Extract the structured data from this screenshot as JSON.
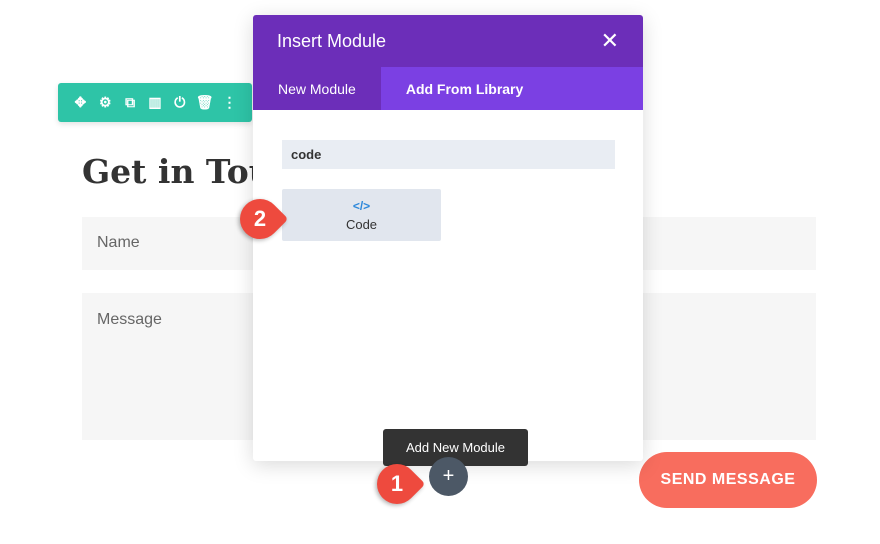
{
  "toolbar": {
    "icons": [
      "move-icon",
      "gear-icon",
      "duplicate-icon",
      "columns-icon",
      "save-icon",
      "trash-icon",
      "more-icon"
    ],
    "color": "#2ec4a7"
  },
  "page": {
    "heading": "Get in Tou",
    "name_placeholder": "Name",
    "message_placeholder": "Message",
    "send_label": "SEND MESSAGE"
  },
  "modal": {
    "title": "Insert Module",
    "tabs": [
      {
        "label": "New Module",
        "active": true
      },
      {
        "label": "Add From Library",
        "active": false
      }
    ],
    "search_value": "code",
    "results": [
      {
        "icon": "</>",
        "label": "Code"
      }
    ]
  },
  "tooltip": "Add New Module",
  "badges": [
    "1",
    "2"
  ],
  "colors": {
    "purple": "#6c2eb9",
    "send": "#f86d5e"
  }
}
